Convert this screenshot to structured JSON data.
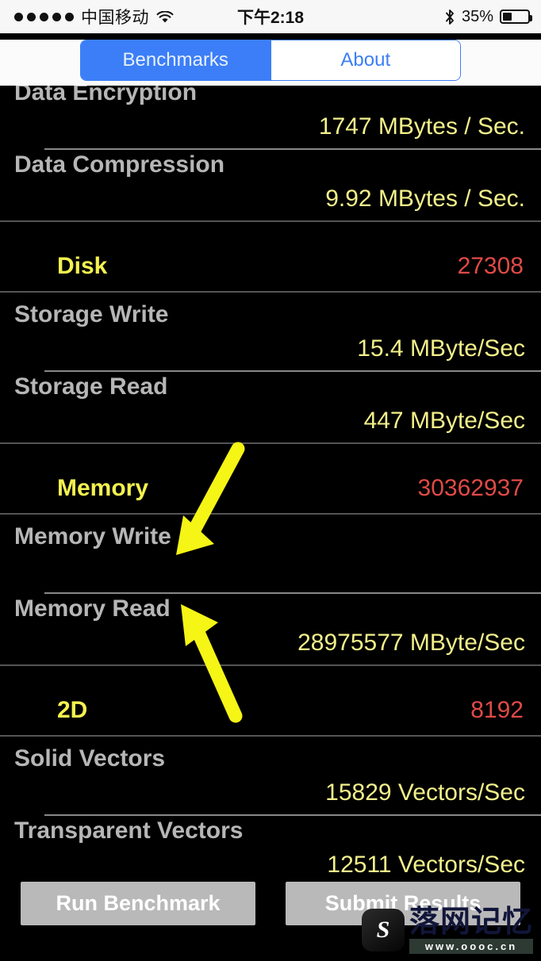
{
  "status_bar": {
    "signal_dots": 5,
    "carrier": "中国移动",
    "wifi_icon": "wifi-icon",
    "time": "下午2:18",
    "bluetooth_icon": "bluetooth-icon",
    "battery_percent": "35%",
    "battery_level": 35
  },
  "segmented_control": {
    "tabs": [
      {
        "label": "Benchmarks",
        "active": true
      },
      {
        "label": "About",
        "active": false
      }
    ],
    "active_color": "#3b7ef7",
    "inactive_text_color": "#3b7ef7"
  },
  "benchmarks": {
    "rows": [
      {
        "type": "item",
        "label": "Data Encryption",
        "value": "1747 MBytes / Sec."
      },
      {
        "type": "item",
        "label": "Data Compression",
        "value": "9.92 MBytes / Sec."
      },
      {
        "type": "header",
        "label": "Disk",
        "score": "27308"
      },
      {
        "type": "item",
        "label": "Storage Write",
        "value": "15.4 MByte/Sec"
      },
      {
        "type": "item",
        "label": "Storage Read",
        "value": "447 MByte/Sec"
      },
      {
        "type": "header",
        "label": "Memory",
        "score": "30362937"
      },
      {
        "type": "item",
        "label": "Memory Write",
        "value": ""
      },
      {
        "type": "item",
        "label": "Memory Read",
        "value": "28975577 MByte/Sec"
      },
      {
        "type": "header",
        "label": "2D",
        "score": "8192"
      },
      {
        "type": "item",
        "label": "Solid Vectors",
        "value": "15829 Vectors/Sec"
      },
      {
        "type": "item",
        "label": "Transparent Vectors",
        "value": "12511 Vectors/Sec"
      }
    ],
    "value_color": "#f2f08a",
    "score_color": "#e04a46",
    "header_label_color": "#f4f24e",
    "label_color": "#b6b6b6"
  },
  "annotations": {
    "arrow_color": "#f5f516",
    "arrows": [
      {
        "name": "arrow-memory-write",
        "direction": "down-left"
      },
      {
        "name": "arrow-memory-read",
        "direction": "up-left"
      }
    ]
  },
  "buttons": {
    "run": "Run Benchmark",
    "submit": "Submit Results"
  },
  "watermark": {
    "logo_glyph": "S",
    "title": "落网记忆",
    "url": "www.oooc.cn"
  }
}
